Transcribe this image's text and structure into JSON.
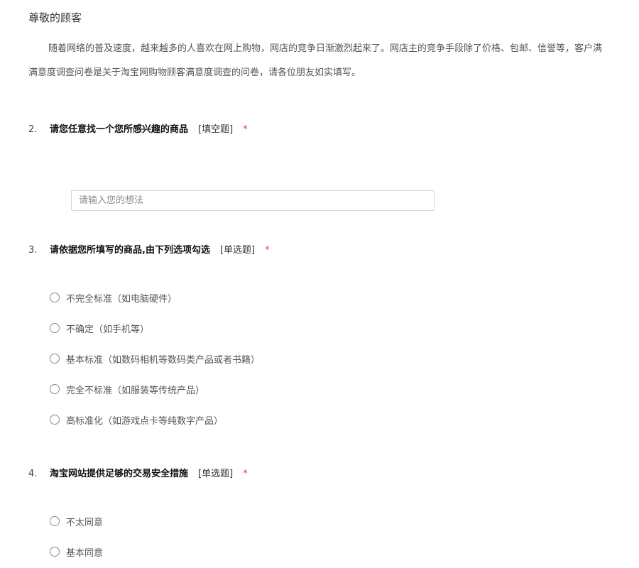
{
  "survey": {
    "greeting": "尊敬的顾客",
    "intro_line1": "随着网络的普及速度，越来越多的人喜欢在网上购物，网店的竞争日渐激烈起来了。网店主的竞争手段除了价格、包邮、信誉等，客户满",
    "intro_line2": "满意度调查问卷是关于淘宝网购物顾客满意度调查的问卷，请各位朋友如实填写。"
  },
  "questions": [
    {
      "number": "2.",
      "text": "请您任意找一个您所感兴趣的商品",
      "type": "[填空题]",
      "required": "*",
      "placeholder": "请输入您的想法"
    },
    {
      "number": "3.",
      "text": "请依据您所填写的商品,由下列选项勾选",
      "type": "[单选题]",
      "required": "*",
      "options": [
        "不完全标准（如电脑硬件）",
        "不确定（如手机等）",
        "基本标准（如数码相机等数码类产品或者书籍）",
        "完全不标准（如服装等传统产品）",
        "高标准化（如游戏点卡等纯数字产品）"
      ]
    },
    {
      "number": "4.",
      "text": "淘宝网站提供足够的交易安全措施",
      "type": "[单选题]",
      "required": "*",
      "options": [
        "不太同意",
        "基本同意"
      ]
    }
  ],
  "colors": {
    "required_star": "#e4393c",
    "input_border": "#d4d4d4",
    "radio_border": "#8a8a8a"
  }
}
